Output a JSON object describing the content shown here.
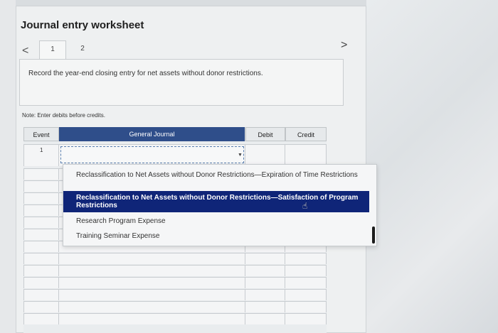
{
  "worksheet": {
    "title": "Journal entry worksheet",
    "tabs": [
      {
        "label": "1",
        "active": true
      },
      {
        "label": "2",
        "active": false
      }
    ],
    "prev_arrow": "<",
    "next_arrow": ">",
    "instruction": "Record the year-end closing entry for net assets without donor restrictions.",
    "note": "Note: Enter debits before credits."
  },
  "table": {
    "headers": {
      "event": "Event",
      "journal": "General Journal",
      "debit": "Debit",
      "credit": "Credit"
    },
    "first_event": "1"
  },
  "dropdown": {
    "options": [
      "Reclassification to Net Assets without Donor Restrictions—Expiration of Time Restrictions",
      "Reclassification to Net Assets without Donor Restrictions—Satisfaction of Program Restrictions",
      "Research Program Expense",
      "Training Seminar Expense"
    ],
    "highlighted_index": 1
  },
  "colors": {
    "header_blue": "#2f4e8a",
    "highlight_navy": "#0f2578"
  }
}
